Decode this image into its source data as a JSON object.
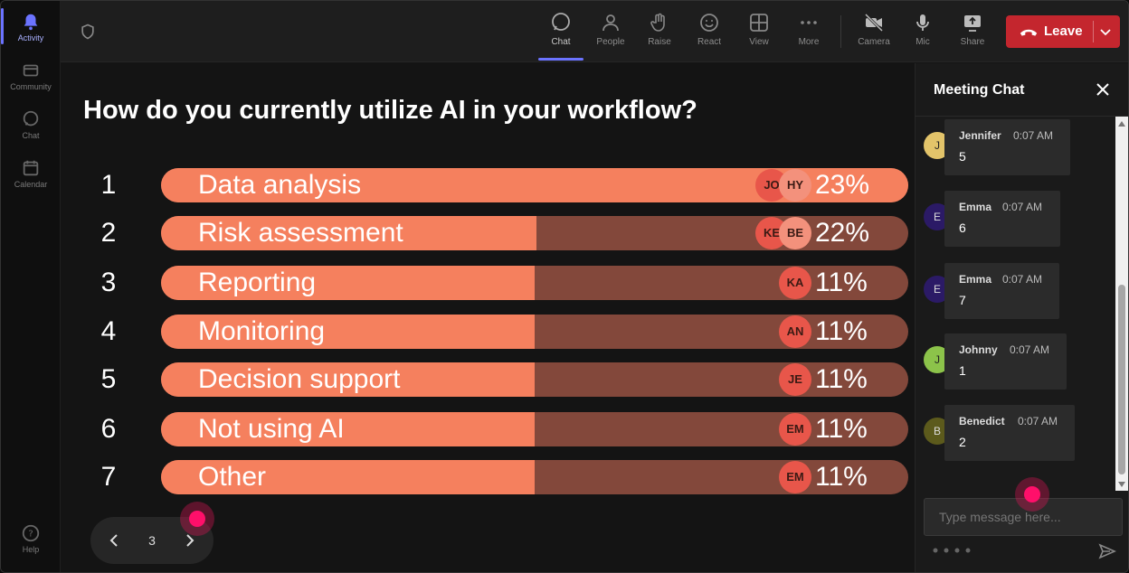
{
  "rail": {
    "items": [
      {
        "label": "Activity",
        "icon": "bell-icon"
      },
      {
        "label": "Community",
        "icon": "community-icon"
      },
      {
        "label": "Chat",
        "icon": "chat-icon"
      },
      {
        "label": "Calendar",
        "icon": "calendar-icon"
      }
    ],
    "help": "Help"
  },
  "toolbar": {
    "chat": "Chat",
    "people": "People",
    "raise": "Raise",
    "react": "React",
    "view": "View",
    "more": "More",
    "camera": "Camera",
    "mic": "Mic",
    "share": "Share",
    "leave": "Leave"
  },
  "poll": {
    "question": "How do you currently utilize AI in your workflow?",
    "options": [
      {
        "num": "1",
        "label": "Data analysis",
        "pct": "23%",
        "fill": 1.0,
        "avatars": [
          "JO",
          "HY"
        ]
      },
      {
        "num": "2",
        "label": "Risk assessment",
        "pct": "22%",
        "fill": 0.503,
        "avatars": [
          "KE",
          "BE"
        ]
      },
      {
        "num": "3",
        "label": "Reporting",
        "pct": "11%",
        "fill": 0.5,
        "avatars": [
          "KA"
        ]
      },
      {
        "num": "4",
        "label": "Monitoring",
        "pct": "11%",
        "fill": 0.5,
        "avatars": [
          "AN"
        ]
      },
      {
        "num": "5",
        "label": "Decision support",
        "pct": "11%",
        "fill": 0.5,
        "avatars": [
          "JE"
        ]
      },
      {
        "num": "6",
        "label": "Not using AI",
        "pct": "11%",
        "fill": 0.5,
        "avatars": [
          "EM"
        ]
      },
      {
        "num": "7",
        "label": "Other",
        "pct": "11%",
        "fill": 0.5,
        "avatars": [
          "EM"
        ]
      }
    ],
    "page": "3"
  },
  "chat": {
    "title": "Meeting Chat",
    "messages": [
      {
        "initial": "J",
        "name": "Jennifer",
        "time": "0:07 AM",
        "text": "5",
        "color": "#e3c46a"
      },
      {
        "initial": "E",
        "name": "Emma",
        "time": "0:07 AM",
        "text": "6",
        "color": "#2b1a66"
      },
      {
        "initial": "E",
        "name": "Emma",
        "time": "0:07 AM",
        "text": "7",
        "color": "#2b1a66"
      },
      {
        "initial": "J",
        "name": "Johnny",
        "time": "0:07 AM",
        "text": "1",
        "color": "#8cc34a"
      },
      {
        "initial": "B",
        "name": "Benedict",
        "time": "0:07 AM",
        "text": "2",
        "color": "#5c5a1c"
      }
    ],
    "placeholder": "Type message here..."
  },
  "colors": {
    "bar_fill": "#f5805e",
    "bar_track": "#83483b",
    "leave": "#c4262e",
    "accent": "#6b73ff"
  }
}
